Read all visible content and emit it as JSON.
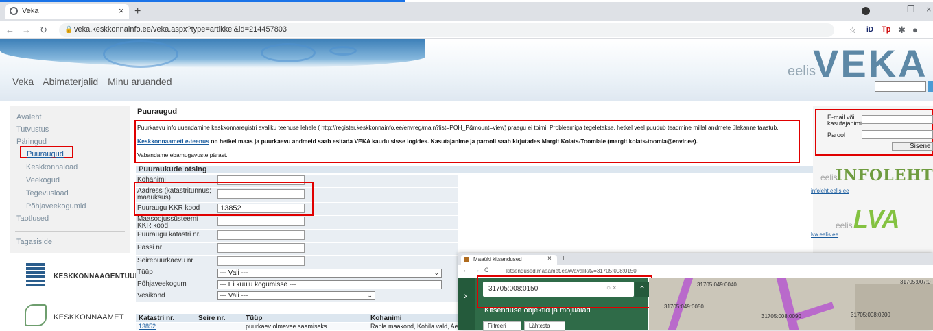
{
  "browser": {
    "tab_title": "Veka",
    "url": "veka.keskkonnainfo.ee/veka.aspx?type=artikkel&id=214457803"
  },
  "header": {
    "brand": "VEKA",
    "brand_prefix": "eelis",
    "nav": [
      "Veka",
      "Abimaterjalid",
      "Minu aruanded"
    ]
  },
  "sidebar": {
    "items": [
      "Avaleht",
      "Tutvustus",
      "Päringud"
    ],
    "sub_items": [
      "Puuraugud",
      "Keskkonnaload",
      "Veekogud",
      "Tegevusload",
      "Põhjaveekogumid"
    ],
    "after": "Taotlused",
    "feedback": "Tagasiside",
    "logo1": "KESKKONNAAGENTUUR",
    "logo2": "KESKKONNAAMET"
  },
  "main": {
    "title": "Puuraugud",
    "notice1": "Puurkaevu info uuendamine keskkonnaregistri avaliku teenuse lehele ( http://register.keskkonnainfo.ee/envreg/main?list=POH_P&mount=view) praegu ei toimi. Probleemiga tegeletakse, hetkel veel puudub teadmine millal andmete ülekanne taastub.",
    "notice2_link": "Keskkonnaameti e-teenus",
    "notice2_rest": " on hetkel maas ja puurkaevu andmeid saab esitada VEKA kaudu sisse logides. Kasutajanime ja parooli saab kirjutades Margit Kolats-Toomlale (margit.kolats-toomla@envir.ee).",
    "notice3": "Vabandame ebamugavuste pärast.",
    "search_header": "Puuraukude otsing",
    "fields": {
      "kohanimi": "Kohanimi",
      "aadress": "Aadress (katastritunnus; maaüksus)",
      "kkr_label": "Puuraugu KKR kood",
      "kkr_value": "13852",
      "maasoojus": "Maasoojussüsteemi KKR kood",
      "katastri": "Puuraugu katastri nr.",
      "passi": "Passi nr",
      "seire": "Seirepuurkaevu nr",
      "tyyp": "Tüüp",
      "tyyp_value": "--- Vali ---",
      "pohjavee": "Põhjaveekogum",
      "pohjavee_value": "--- Ei kuulu kogumisse ---",
      "vesikond": "Vesikond",
      "vesikond_value": "--- Vali ---"
    },
    "results": {
      "headers": [
        "Katastri nr.",
        "Seire nr.",
        "Tüüp",
        "Kohanimi"
      ],
      "row": [
        "13852",
        "",
        "puurkaev olmevee saamiseks",
        "Rapla maakond, Kohila vald, Aes"
      ]
    }
  },
  "login": {
    "email_label": "E-mail või kasutajanimi",
    "password_label": "Parool",
    "submit": "Sisene"
  },
  "ads": {
    "infoleht_logo": "INFOLEHT",
    "infoleht_link": "infoleht.eelis.ee",
    "lva_logo": "LVA",
    "lva_link": "lva.eelis.ee"
  },
  "popup": {
    "tab_title": "Maaüki kitsendused",
    "url": "kitsendused.maaamet.ee/#/avalik/tv=31705:008:0150",
    "search_value": "31705:008:0150",
    "panel_title": "Kitsenduse objektid ja mõjualad",
    "btn_filter": "Filtreeri",
    "btn_reset": "Lähtesta",
    "map_labels": [
      "31705:049:0040",
      "31705:049:0050",
      "31705:008:0090",
      "31705:008:0200",
      "31705:007:0"
    ]
  },
  "colors": {
    "highlight": "#e00000",
    "link": "#1a5c9e",
    "header_blue": "#dce6ef"
  }
}
